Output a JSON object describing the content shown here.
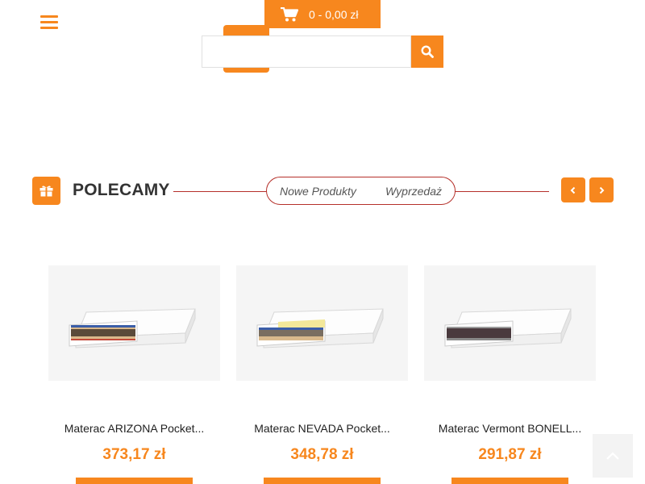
{
  "header": {
    "menu_icon": "hamburger-menu-icon",
    "cart": {
      "icon": "shopping-cart-icon",
      "text": "0 - 0,00 zł"
    },
    "search": {
      "placeholder": "",
      "value": "",
      "button_icon": "search-icon"
    }
  },
  "section": {
    "icon": "gift-icon",
    "title": "POLECAMY",
    "tabs": [
      {
        "label": "Nowe Produkty"
      },
      {
        "label": "Wyprzedaż"
      }
    ],
    "prev_icon": "chevron-left-icon",
    "next_icon": "chevron-right-icon"
  },
  "products": [
    {
      "name": "Materac ARIZONA Pocket...",
      "price": "373,17 zł"
    },
    {
      "name": "Materac NEVADA Pocket...",
      "price": "348,78 zł"
    },
    {
      "name": "Materac Vermont BONELL...",
      "price": "291,87 zł"
    }
  ],
  "back_to_top_icon": "chevron-up-icon",
  "colors": {
    "accent": "#f7871e",
    "line": "#b5302a",
    "price": "#f7871e"
  }
}
